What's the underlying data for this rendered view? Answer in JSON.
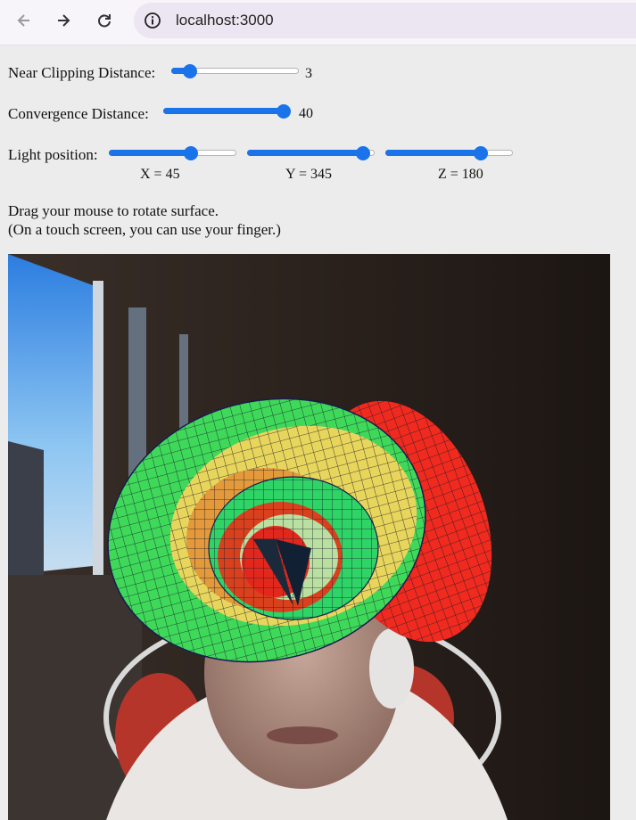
{
  "browser": {
    "url": "localhost:3000",
    "icons": {
      "back": "arrow-left-icon",
      "forward": "arrow-right-icon",
      "reload": "reload-icon",
      "info": "info-icon"
    }
  },
  "controls": {
    "near_clipping": {
      "label": "Near Clipping Distance:",
      "value": "3",
      "fraction": 0.1
    },
    "convergence": {
      "label": "Convergence Distance:",
      "value": "40",
      "fraction": 1.0
    },
    "light": {
      "label": "Light position:",
      "x": {
        "label": "X = 45",
        "fraction": 0.66
      },
      "y": {
        "label": "Y = 345",
        "fraction": 0.96
      },
      "z": {
        "label": "Z = 180",
        "fraction": 0.78
      }
    }
  },
  "help": {
    "line1": "Drag your mouse to rotate surface.",
    "line2": "(On a touch screen, you can use your finger.)"
  },
  "colors": {
    "accent": "#1a73e8",
    "surface_green": "#3fd95a",
    "surface_red": "#f02a1e",
    "surface_yellow": "#e8d65c"
  }
}
